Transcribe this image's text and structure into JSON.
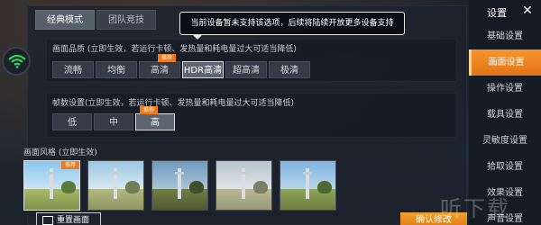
{
  "tabs": [
    {
      "label": "经典模式"
    },
    {
      "label": "团队竞技"
    }
  ],
  "tooltip": "当前设备暂未支持该选项，后续将陆续开放更多设备支持",
  "quality": {
    "title": "画面品质 (立即生效，若运行卡顿、发热量和耗电量过大可适当降低)",
    "options": [
      "流畅",
      "均衡",
      "高清",
      "HDR高清",
      "超高清",
      "极清"
    ],
    "selected": "HDR高清",
    "recommended": "高清",
    "badge": "推荐"
  },
  "fps": {
    "title": "帧数设置(立即生效，若运行卡顿、发热量和耗电量过大可适当降低)",
    "options": [
      "低",
      "中",
      "高"
    ],
    "selected": "高",
    "recommended": "高",
    "badge": "推荐"
  },
  "style": {
    "title": "画面风格 (立即生效)",
    "badge": "推荐",
    "thumbnails": 5,
    "selected_index": 0
  },
  "reset_label": "重置画面",
  "sidebar": {
    "title": "设置",
    "close": "✕",
    "items": [
      "基础设置",
      "画面设置",
      "操作设置",
      "载具设置",
      "灵敏度设置",
      "拾取设置",
      "效果设置",
      "声音设置"
    ],
    "active": "画面设置"
  },
  "apply_label": "确认修改",
  "watermark": "听下载",
  "colors": {
    "accent": "#ef7a1a",
    "wifi": "#2bd65a"
  }
}
